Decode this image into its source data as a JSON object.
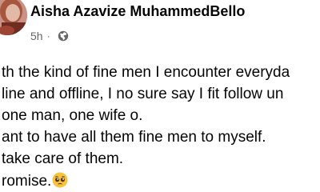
{
  "post": {
    "author_name": "Aisha Azavize MuhammedBello",
    "timestamp": "5h",
    "separator": "·",
    "privacy_icon": "globe-icon",
    "avatar_icon": "profile-photo",
    "lines": [
      "th the kind of fine men I encounter everyda",
      "line and offline, I no sure say I fit follow un",
      "one man, one wife o.",
      "ant to have all them fine men to myself.",
      "take care of them.",
      "romise."
    ],
    "emoji_icon": "pleading-face-emoji"
  },
  "colors": {
    "text": "#050505",
    "meta": "#65676b",
    "background": "#ffffff",
    "emoji": "#f7c23c"
  }
}
